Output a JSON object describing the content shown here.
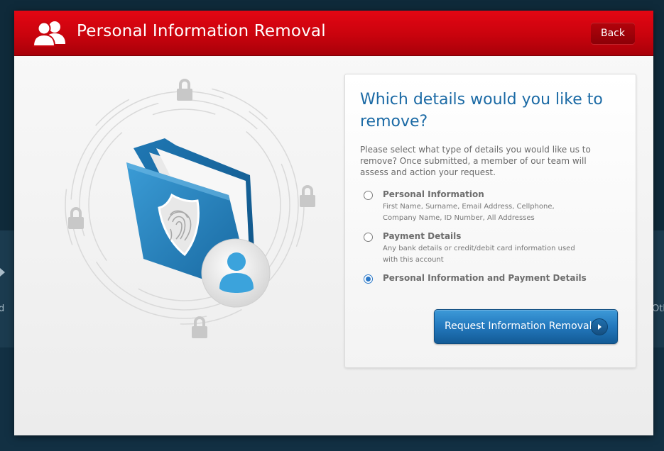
{
  "header": {
    "title": "Personal Information Removal",
    "back_label": "Back",
    "icon": "users-icon"
  },
  "panel": {
    "title": "Which details would you like to remove?",
    "description": "Please select what type of details you would like us to remove? Once submitted, a member of our team will assess and action your request.",
    "options": [
      {
        "title": "Personal Information",
        "description": "First Name, Surname, Email Address, Cellphone, Company Name, ID Number, All Addresses",
        "checked": false
      },
      {
        "title": "Payment Details",
        "description": "Any bank details or credit/debit card information used with this account",
        "checked": false
      },
      {
        "title": "Personal Information and Payment Details",
        "description": "",
        "checked": true
      }
    ],
    "submit_label": "Request Information Removal"
  },
  "illustration": {
    "icons": [
      "padlock-icon",
      "folder-icon",
      "fingerprint-shield-icon",
      "user-avatar-icon"
    ]
  },
  "background": {
    "left_fragment": "d",
    "right_fragment": "Oth"
  },
  "colors": {
    "header_red": "#d4050f",
    "title_blue": "#1b6aa5",
    "button_blue": "#2378bd",
    "radio_selected": "#2a78c8"
  }
}
